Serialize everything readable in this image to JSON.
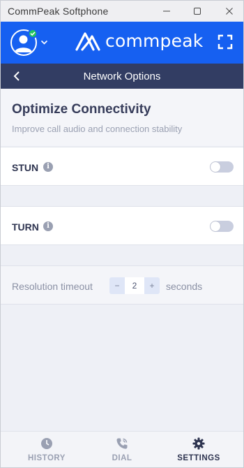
{
  "window": {
    "title": "CommPeak Softphone"
  },
  "brand": {
    "name": "commpeak",
    "accent": "#1660f1",
    "status_color": "#22c55e"
  },
  "header": {
    "title": "Network Options"
  },
  "intro": {
    "title": "Optimize Connectivity",
    "subtitle": "Improve call audio and connection stability"
  },
  "settings": {
    "stun": {
      "label": "STUN",
      "enabled": false
    },
    "turn": {
      "label": "TURN",
      "enabled": false
    },
    "resolution": {
      "label": "Resolution timeout",
      "value": "2",
      "unit": "seconds",
      "minus": "−",
      "plus": "+"
    }
  },
  "nav": {
    "items": [
      {
        "label": "HISTORY",
        "icon": "clock-icon"
      },
      {
        "label": "DIAL",
        "icon": "phone-icon"
      },
      {
        "label": "SETTINGS",
        "icon": "gear-icon"
      }
    ],
    "active": "SETTINGS"
  }
}
